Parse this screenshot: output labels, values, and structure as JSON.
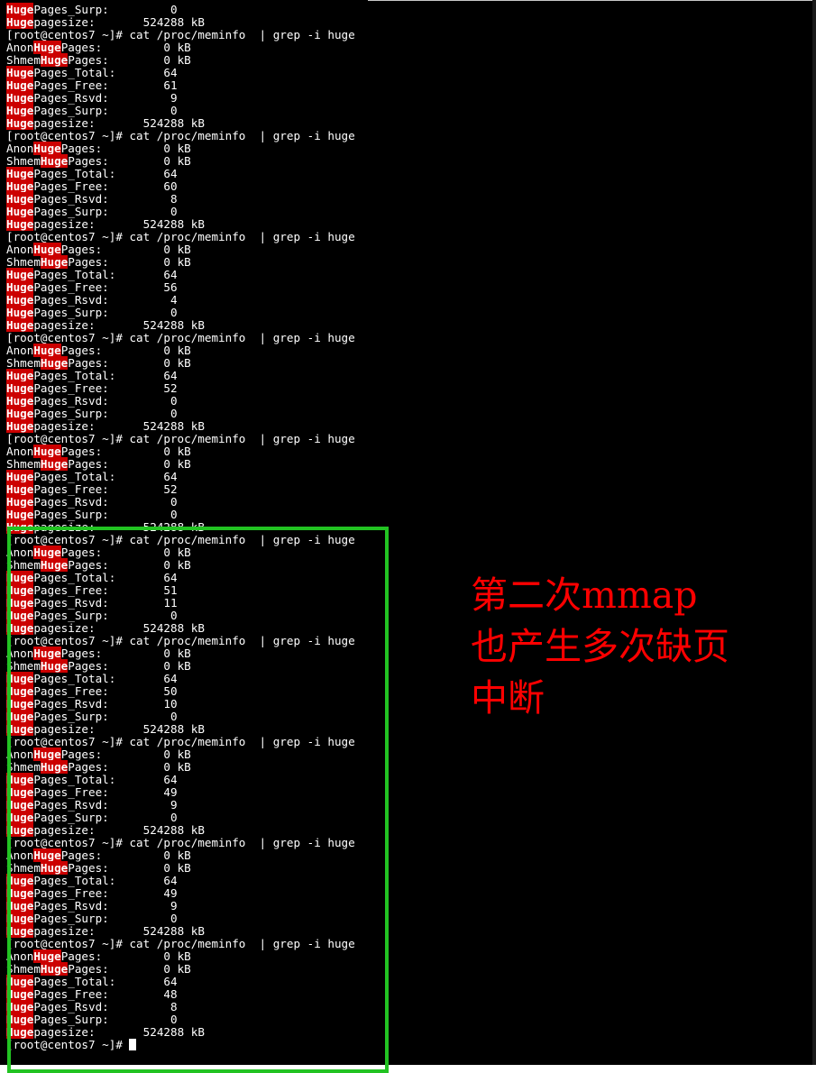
{
  "terminal": {
    "prompt": "[root@centos7 ~]# ",
    "command": "cat /proc/meminfo  | grep -i huge",
    "keyword": "Huge",
    "top_partial": {
      "surp_label": "Pages_Surp:",
      "surp_value": "0",
      "pagesize_label": "pagesize:",
      "pagesize_value": "524288 kB"
    },
    "blocks": [
      {
        "anon": "0 kB",
        "shmem": "0 kB",
        "total": "64",
        "free": "61",
        "rsvd": "9",
        "surp": "0",
        "pagesize": "524288 kB"
      },
      {
        "anon": "0 kB",
        "shmem": "0 kB",
        "total": "64",
        "free": "60",
        "rsvd": "8",
        "surp": "0",
        "pagesize": "524288 kB"
      },
      {
        "anon": "0 kB",
        "shmem": "0 kB",
        "total": "64",
        "free": "56",
        "rsvd": "4",
        "surp": "0",
        "pagesize": "524288 kB"
      },
      {
        "anon": "0 kB",
        "shmem": "0 kB",
        "total": "64",
        "free": "52",
        "rsvd": "0",
        "surp": "0",
        "pagesize": "524288 kB"
      },
      {
        "anon": "0 kB",
        "shmem": "0 kB",
        "total": "64",
        "free": "52",
        "rsvd": "0",
        "surp": "0",
        "pagesize": "524288 kB"
      },
      {
        "anon": "0 kB",
        "shmem": "0 kB",
        "total": "64",
        "free": "51",
        "rsvd": "11",
        "surp": "0",
        "pagesize": "524288 kB"
      },
      {
        "anon": "0 kB",
        "shmem": "0 kB",
        "total": "64",
        "free": "50",
        "rsvd": "10",
        "surp": "0",
        "pagesize": "524288 kB"
      },
      {
        "anon": "0 kB",
        "shmem": "0 kB",
        "total": "64",
        "free": "49",
        "rsvd": "9",
        "surp": "0",
        "pagesize": "524288 kB"
      },
      {
        "anon": "0 kB",
        "shmem": "0 kB",
        "total": "64",
        "free": "49",
        "rsvd": "9",
        "surp": "0",
        "pagesize": "524288 kB"
      },
      {
        "anon": "0 kB",
        "shmem": "0 kB",
        "total": "64",
        "free": "48",
        "rsvd": "8",
        "surp": "0",
        "pagesize": "524288 kB"
      }
    ]
  },
  "annotation": {
    "lines": [
      "第二次mmap",
      "也产生多次缺页",
      "中断"
    ]
  },
  "colors": {
    "terminal_bg": "#000000",
    "terminal_text": "#ffffff",
    "match_highlight": "#cc0000",
    "box_border": "#22c322",
    "annotation_text": "#ff0000"
  }
}
